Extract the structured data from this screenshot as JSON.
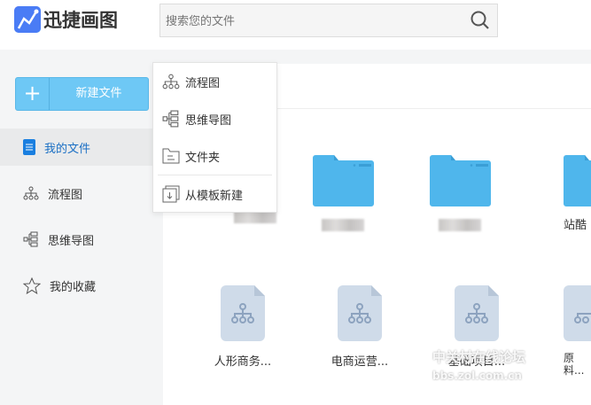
{
  "app": {
    "name": "迅捷画图"
  },
  "search": {
    "placeholder": "搜索您的文件"
  },
  "sidebar": {
    "new_file": "新建文件",
    "items": [
      {
        "label": "我的文件"
      },
      {
        "label": "流程图"
      },
      {
        "label": "思维导图"
      },
      {
        "label": "我的收藏"
      }
    ]
  },
  "new_menu": {
    "items": [
      {
        "label": "流程图"
      },
      {
        "label": "思维导图"
      },
      {
        "label": "文件夹"
      },
      {
        "label": "从模板新建"
      }
    ]
  },
  "folders": [
    {
      "name": ""
    },
    {
      "name": ""
    },
    {
      "name": ""
    },
    {
      "name": "站酷"
    }
  ],
  "files": [
    {
      "name": "人形商务..."
    },
    {
      "name": "电商运营..."
    },
    {
      "name": "基础项目..."
    },
    {
      "name": "原料..."
    }
  ],
  "watermark": {
    "line1": "中关村在线论坛",
    "line2": "bbs.zol.com.cn"
  },
  "colors": {
    "accent": "#6ec8f5",
    "folder": "#4fb6ec",
    "active": "#1a6fc4"
  }
}
